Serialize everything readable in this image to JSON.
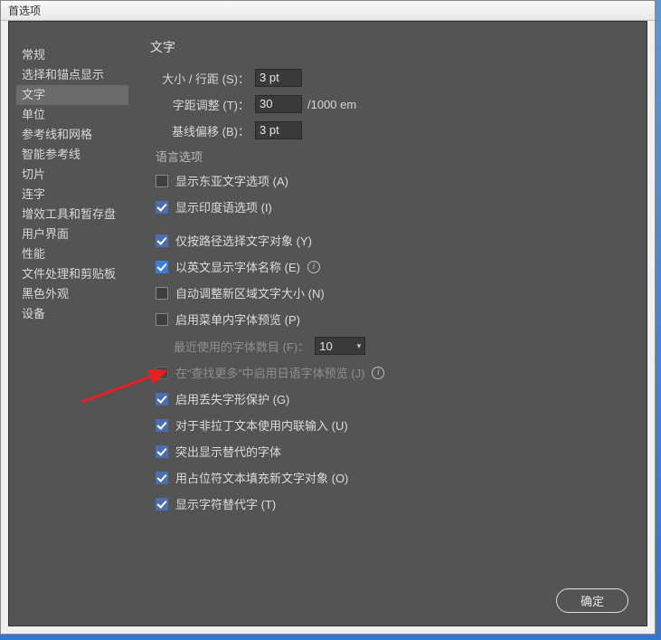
{
  "window": {
    "title": "首选项"
  },
  "sidebar": {
    "items": [
      {
        "label": "常规"
      },
      {
        "label": "选择和锚点显示"
      },
      {
        "label": "文字",
        "selected": true
      },
      {
        "label": "单位"
      },
      {
        "label": "参考线和网格"
      },
      {
        "label": "智能参考线"
      },
      {
        "label": "切片"
      },
      {
        "label": "连字"
      },
      {
        "label": "增效工具和暂存盘"
      },
      {
        "label": "用户界面"
      },
      {
        "label": "性能"
      },
      {
        "label": "文件处理和剪贴板"
      },
      {
        "label": "黑色外观"
      },
      {
        "label": "设备"
      }
    ]
  },
  "main": {
    "title": "文字",
    "size_leading_label": "大小 / 行距 (S)：",
    "size_leading_value": "3 pt",
    "tracking_label": "字距调整 (T)：",
    "tracking_value": "30",
    "tracking_suffix": "/1000 em",
    "baseline_label": "基线偏移 (B)：",
    "baseline_value": "3 pt",
    "lang_header": "语言选项",
    "show_east_asian": {
      "label": "显示东亚文字选项 (A)",
      "checked": false
    },
    "show_indic": {
      "label": "显示印度语选项 (I)",
      "checked": true
    },
    "select_path": {
      "label": "仅按路径选择文字对象 (Y)",
      "checked": true
    },
    "english_font": {
      "label": "以英文显示字体名称 (E)",
      "checked": true,
      "info": true
    },
    "auto_size": {
      "label": "自动调整新区域文字大小 (N)",
      "checked": false
    },
    "menu_preview": {
      "label": "启用菜单内字体预览 (P)",
      "checked": false
    },
    "recent_fonts_label": "最近使用的字体数目 (F)：",
    "recent_fonts_value": "10",
    "jp_preview": {
      "label": "在“查找更多”中启用日语字体预览 (J)",
      "checked": false,
      "info": true
    },
    "glyph_protect": {
      "label": "启用丢失字形保护 (G)",
      "checked": true
    },
    "inline_input": {
      "label": "对于非拉丁文本使用内联输入 (U)",
      "checked": true
    },
    "highlight_alt": {
      "label": "突出显示替代的字体",
      "checked": true
    },
    "placeholder": {
      "label": "用占位符文本填充新文字对象 (O)",
      "checked": true
    },
    "show_glyph_alt": {
      "label": "显示字符替代字 (T)",
      "checked": true
    }
  },
  "buttons": {
    "ok": "确定"
  }
}
